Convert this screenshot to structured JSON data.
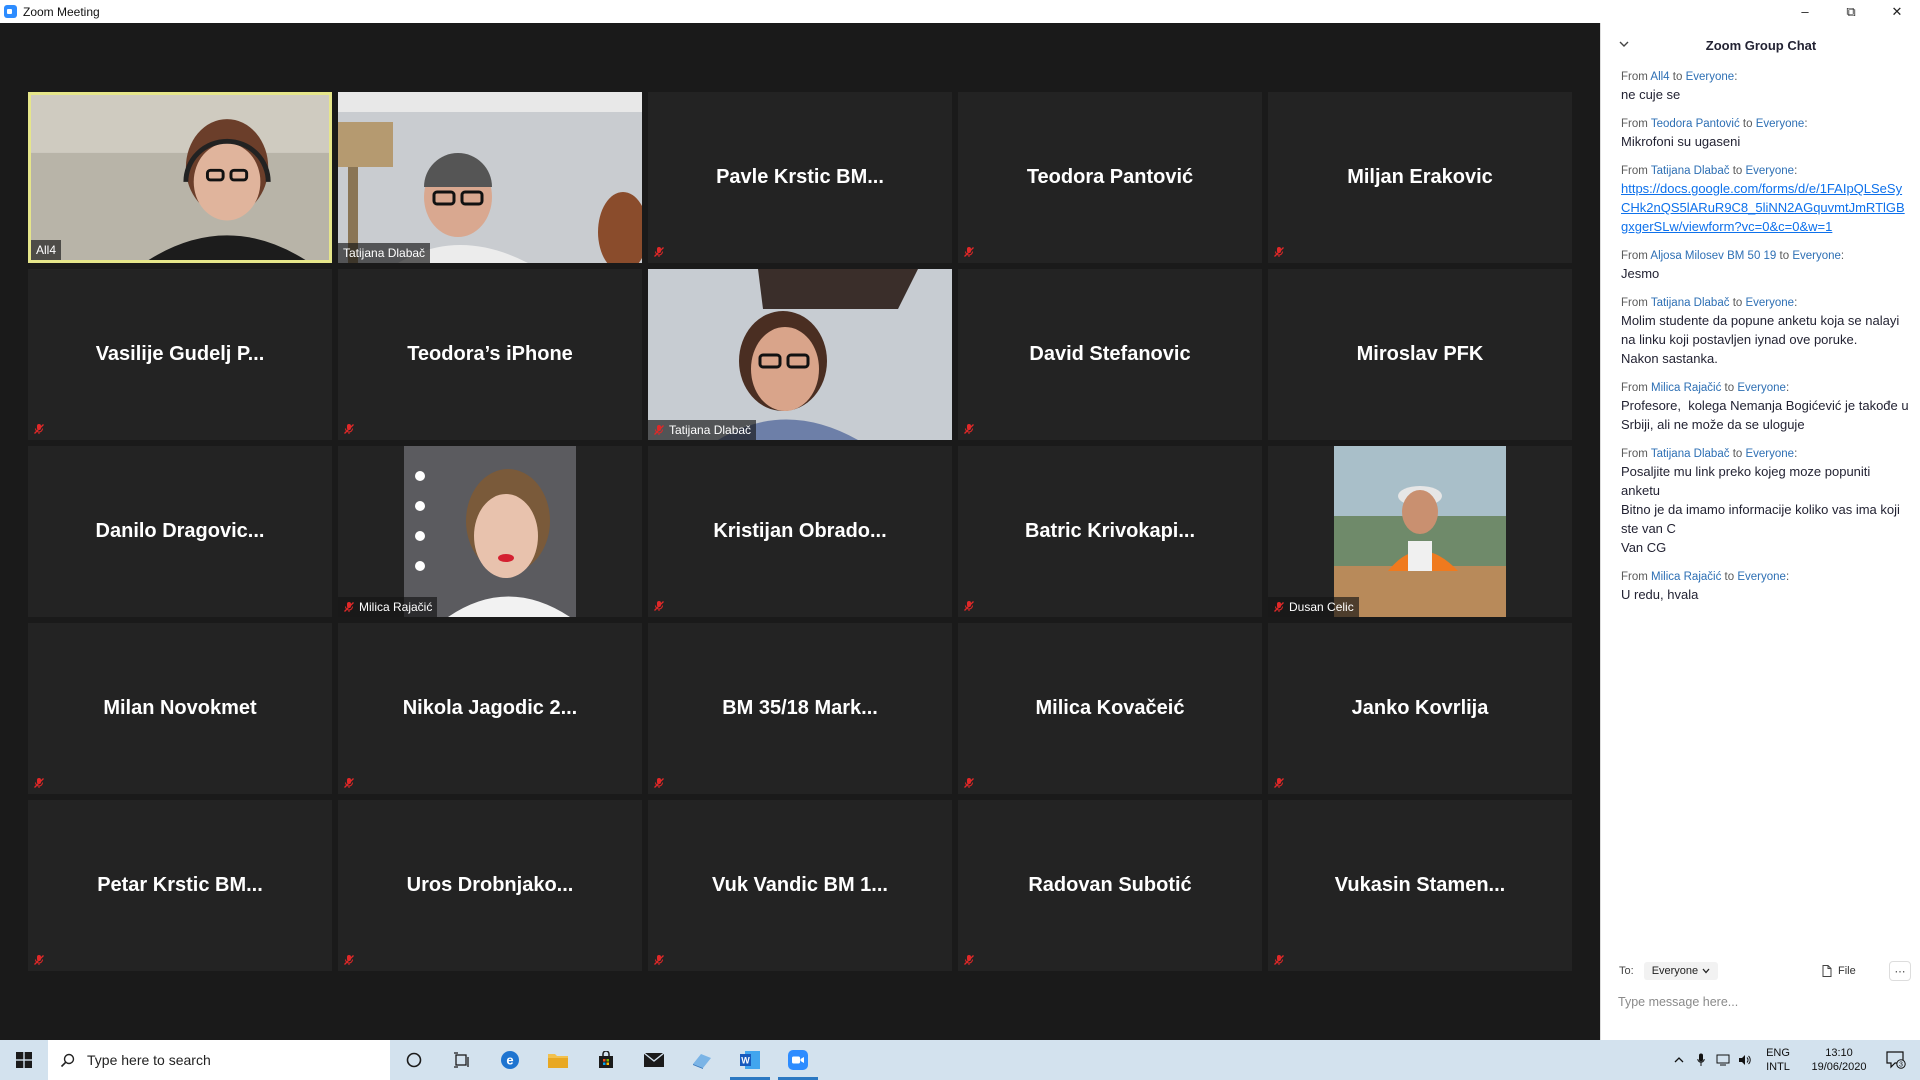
{
  "window": {
    "title": "Zoom Meeting",
    "minimize": "–",
    "restore": "⧉",
    "close": "✕"
  },
  "participants": [
    {
      "name": "All4",
      "video": true,
      "kind": "woman-headset",
      "active": true,
      "muted": false
    },
    {
      "name": "Tatijana Dlabač",
      "video": true,
      "kind": "man-glasses",
      "active": false,
      "muted": false
    },
    {
      "name": "Pavle Krstic BM...",
      "video": false,
      "muted": true
    },
    {
      "name": "Teodora Pantović",
      "video": false,
      "muted": true
    },
    {
      "name": "Miljan Erakovic",
      "video": false,
      "muted": true
    },
    {
      "name": "Vasilije Gudelj P...",
      "video": false,
      "muted": true
    },
    {
      "name": "Teodora’s iPhone",
      "video": false,
      "muted": true
    },
    {
      "name": "Tatijana Dlabač",
      "video": true,
      "kind": "woman-glasses",
      "muted": true
    },
    {
      "name": "David Stefanovic",
      "video": false,
      "muted": true
    },
    {
      "name": "Miroslav PFK",
      "video": false,
      "muted": false
    },
    {
      "name": "Danilo  Dragovic...",
      "video": false,
      "muted": false
    },
    {
      "name": "Milica Rajačić",
      "video": true,
      "kind": "portrait-woman",
      "muted": true
    },
    {
      "name": "Kristijan  Obrado...",
      "video": false,
      "muted": true
    },
    {
      "name": "Batric  Krivokapi...",
      "video": false,
      "muted": true
    },
    {
      "name": "Dusan Celic",
      "video": true,
      "kind": "portrait-man",
      "muted": true
    },
    {
      "name": "Milan Novokmet",
      "video": false,
      "muted": true
    },
    {
      "name": "Nikola Jagodic 2...",
      "video": false,
      "muted": true
    },
    {
      "name": "BM 35/18 Mark...",
      "video": false,
      "muted": true
    },
    {
      "name": "Milica Kovačeić",
      "video": false,
      "muted": true
    },
    {
      "name": "Janko Kovrlija",
      "video": false,
      "muted": true
    },
    {
      "name": "Petar Krstic BM...",
      "video": false,
      "muted": true
    },
    {
      "name": "Uros  Drobnjako...",
      "video": false,
      "muted": true
    },
    {
      "name": "Vuk Vandic BM 1...",
      "video": false,
      "muted": true
    },
    {
      "name": "Radovan Subotić",
      "video": false,
      "muted": true
    },
    {
      "name": "Vukasin  Stamen...",
      "video": false,
      "muted": true
    }
  ],
  "chat": {
    "title": "Zoom Group Chat",
    "messages": [
      {
        "from": "All4",
        "to": "Everyone",
        "lines": [
          "ne cuje se"
        ]
      },
      {
        "from": "Teodora Pantović",
        "to": "Everyone",
        "lines": [
          "Mikrofoni su ugaseni"
        ]
      },
      {
        "from": "Tatijana Dlabač",
        "to": "Everyone",
        "link": "https://docs.google.com/forms/d/e/1FAIpQLSeSyCHk2nQS5lARuR9C8_5liNN2AGquvmtJmRTlGBgxgerSLw/viewform?vc=0&c=0&w=1",
        "lines": []
      },
      {
        "from": "Aljosa Milosev BM 50 19",
        "to": "Everyone",
        "lines": [
          "Jesmo"
        ]
      },
      {
        "from": "Tatijana Dlabač",
        "to": "Everyone",
        "lines": [
          "Molim studente da popune anketu koja se nalayi na linku koji postavljen iynad ove poruke.",
          "Nakon sastanka."
        ]
      },
      {
        "from": "Milica Rajačić",
        "to": "Everyone",
        "lines": [
          "Profesore,  kolega Nemanja Bogićević je takođe u Srbiji, ali ne može da se uloguje"
        ]
      },
      {
        "from": "Tatijana Dlabač",
        "to": "Everyone",
        "lines": [
          "Posaljite mu link preko kojeg moze popuniti anketu",
          "Bitno je da imamo informacije koliko vas ima koji ste van C",
          "Van CG"
        ]
      },
      {
        "from": "Milica Rajačić",
        "to": "Everyone",
        "lines": [
          "U redu, hvala"
        ]
      }
    ],
    "from_prefix": "From",
    "to_word": "to",
    "to_label": "To:",
    "to_value": "Everyone",
    "file_label": "File",
    "more_label": "⋯",
    "input_placeholder": "Type message here..."
  },
  "taskbar": {
    "search_placeholder": "Type here to search",
    "lang_line1": "ENG",
    "lang_line2": "INTL",
    "time": "13:10",
    "date": "19/06/2020",
    "notifications": "3"
  },
  "colors": {
    "active_speaker": "#e6e68a",
    "taskbar": "#d3e2ee",
    "mute_red": "#e02828",
    "link": "#0e71eb"
  }
}
